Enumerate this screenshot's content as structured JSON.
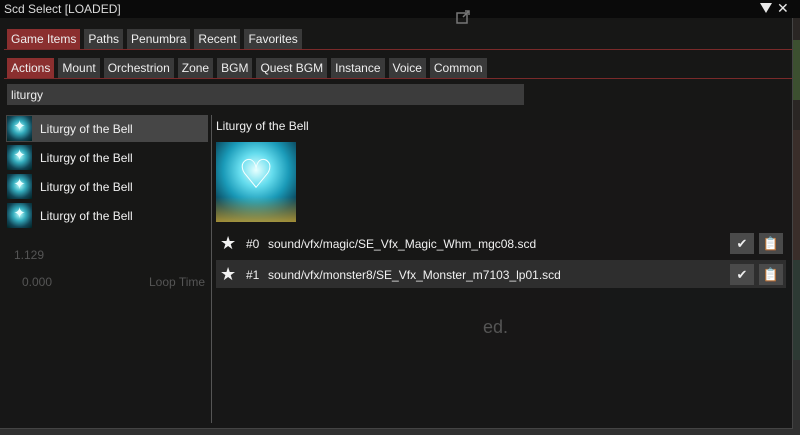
{
  "window": {
    "title": "Scd Select [LOADED]"
  },
  "tabs_primary": [
    {
      "label": "Game Items",
      "active": true
    },
    {
      "label": "Paths",
      "active": false
    },
    {
      "label": "Penumbra",
      "active": false
    },
    {
      "label": "Recent",
      "active": false
    },
    {
      "label": "Favorites",
      "active": false
    }
  ],
  "tabs_secondary": [
    {
      "label": "Actions",
      "active": true
    },
    {
      "label": "Mount",
      "active": false
    },
    {
      "label": "Orchestrion",
      "active": false
    },
    {
      "label": "Zone",
      "active": false
    },
    {
      "label": "BGM",
      "active": false
    },
    {
      "label": "Quest BGM",
      "active": false
    },
    {
      "label": "Instance",
      "active": false
    },
    {
      "label": "Voice",
      "active": false
    },
    {
      "label": "Common",
      "active": false
    }
  ],
  "search": {
    "value": "liturgy",
    "placeholder": ""
  },
  "results": [
    {
      "label": "Liturgy of the Bell",
      "selected": true
    },
    {
      "label": "Liturgy of the Bell",
      "selected": false
    },
    {
      "label": "Liturgy of the Bell",
      "selected": false
    },
    {
      "label": "Liturgy of the Bell",
      "selected": false
    }
  ],
  "detail": {
    "title": "Liturgy of the Bell",
    "files": [
      {
        "index": "#0",
        "path": "sound/vfx/magic/SE_Vfx_Magic_Whm_mgc08.scd"
      },
      {
        "index": "#1",
        "path": "sound/vfx/monster8/SE_Vfx_Monster_m7103_lp01.scd"
      }
    ]
  },
  "background_text": {
    "a": "1.129",
    "b": "0.000",
    "c": "Loop Time",
    "d": "ed."
  },
  "colors": {
    "accent": "#8b2f2f",
    "separator": "#7a2a2a"
  },
  "icons": [
    "popout-icon",
    "collapse-triangle-icon",
    "close-icon",
    "star-icon",
    "check-icon",
    "clipboard-icon",
    "ability-icon"
  ]
}
